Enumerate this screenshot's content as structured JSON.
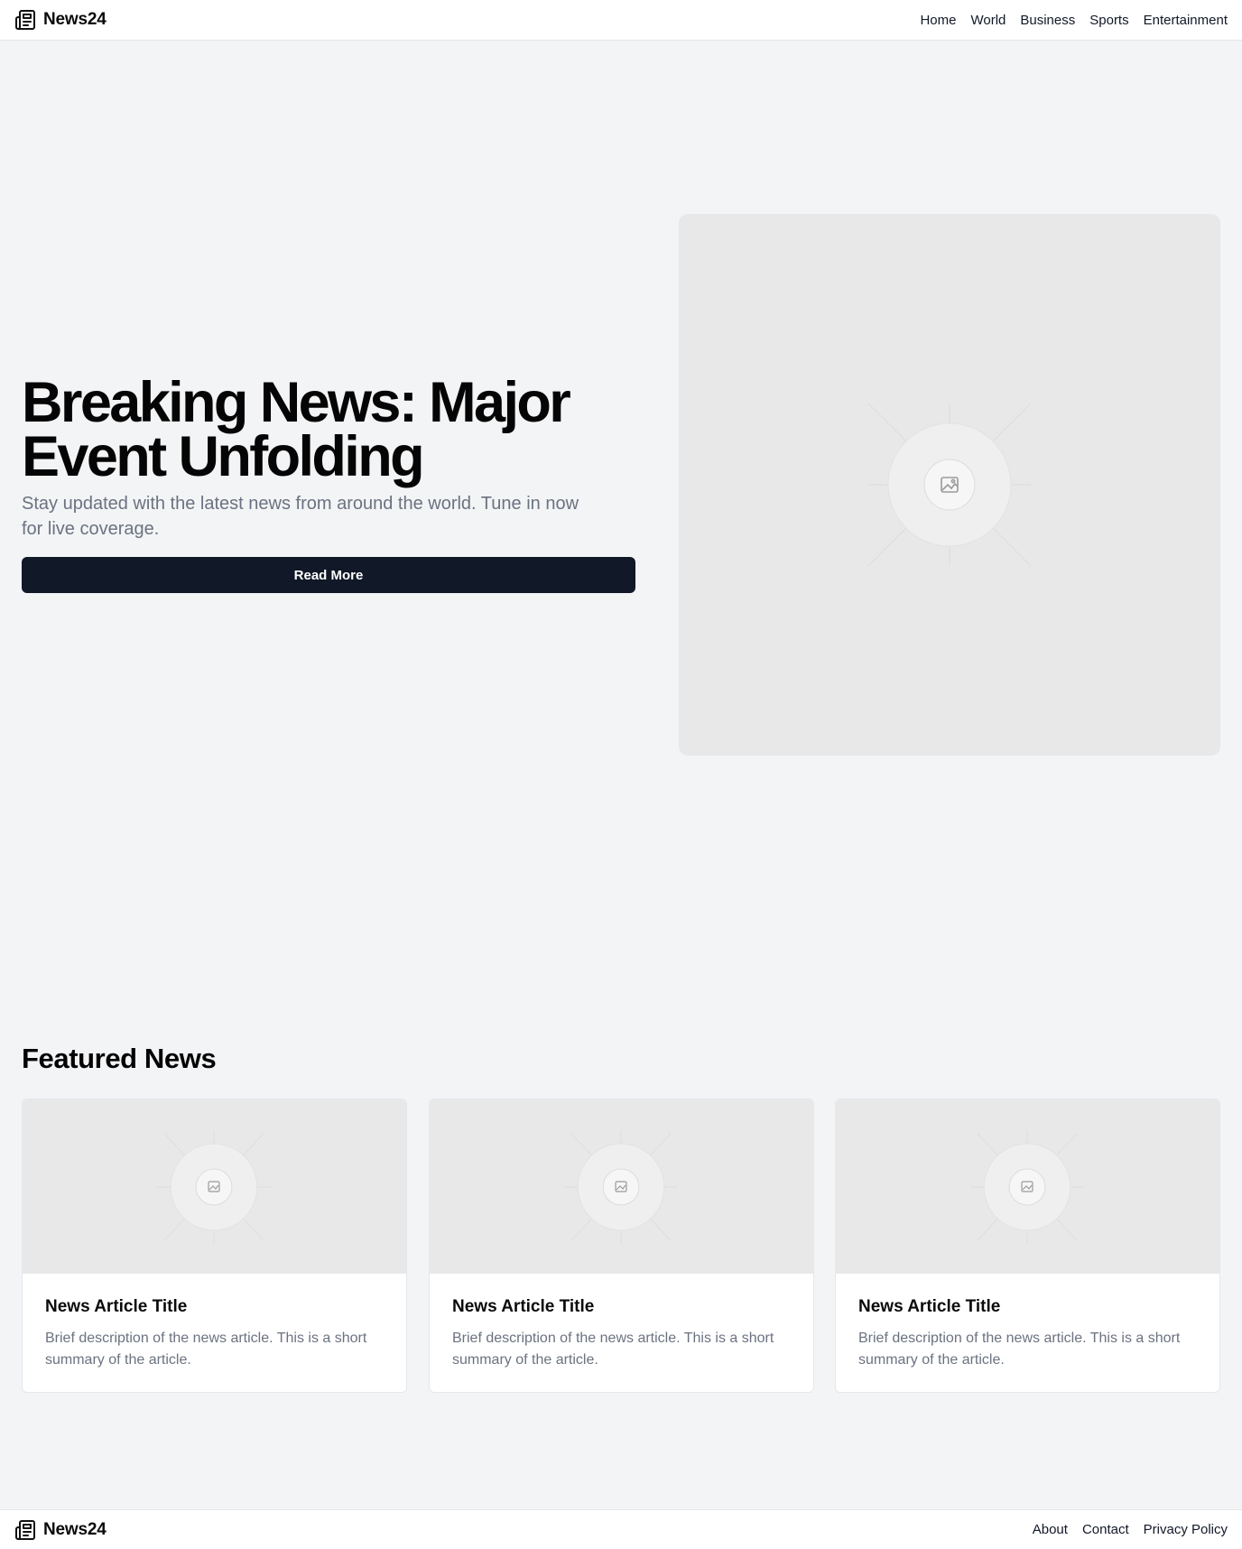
{
  "header": {
    "brand": "News24",
    "nav": [
      "Home",
      "World",
      "Business",
      "Sports",
      "Entertainment"
    ]
  },
  "hero": {
    "title": "Breaking News: Major Event Unfolding",
    "subtitle": "Stay updated with the latest news from around the world. Tune in now for live coverage.",
    "button_label": "Read More"
  },
  "featured": {
    "heading": "Featured News",
    "cards": [
      {
        "title": "News Article Title",
        "description": "Brief description of the news article. This is a short summary of the article."
      },
      {
        "title": "News Article Title",
        "description": "Brief description of the news article. This is a short summary of the article."
      },
      {
        "title": "News Article Title",
        "description": "Brief description of the news article. This is a short summary of the article."
      }
    ]
  },
  "footer": {
    "brand": "News24",
    "links": [
      "About",
      "Contact",
      "Privacy Policy"
    ]
  },
  "icons": {
    "brand": "newspaper-icon",
    "placeholder": "image-placeholder-icon"
  },
  "colors": {
    "primary_button": "#111827",
    "page_background": "#f3f4f6",
    "muted_text": "#6b7280"
  }
}
